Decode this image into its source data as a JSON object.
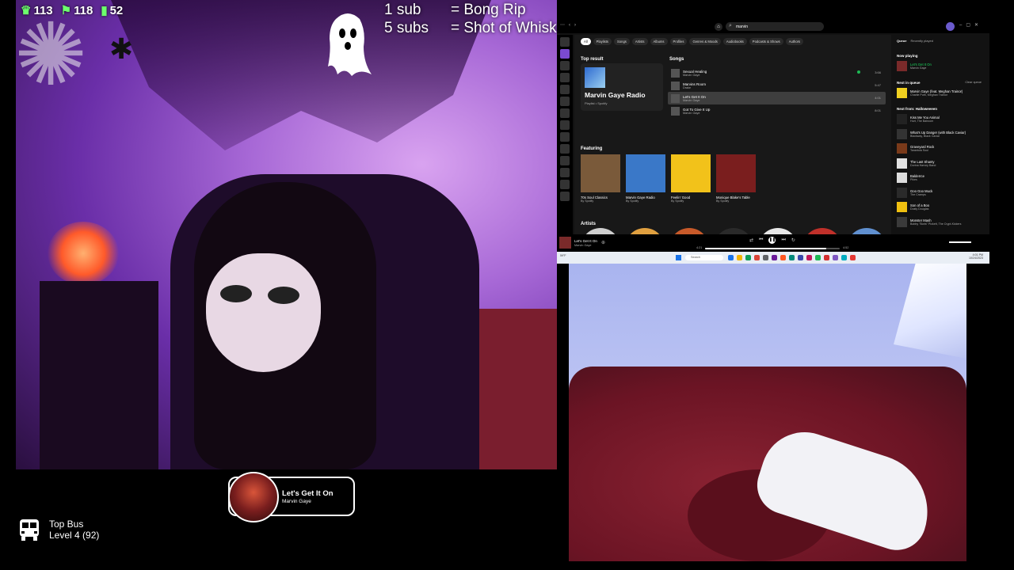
{
  "stats": {
    "item1": "113",
    "item2": "118",
    "item3": "52"
  },
  "sub_rules": [
    {
      "key": "1 sub",
      "value": "= Bong Rip"
    },
    {
      "key": "5 subs",
      "value": "= Shot of Whiskey"
    }
  ],
  "spotify": {
    "search_query": "marvin",
    "filter_chips": [
      "All",
      "Playlists",
      "Songs",
      "Artists",
      "Albums",
      "Profiles",
      "Genres & Moods",
      "Audiobooks",
      "Podcasts & Shows",
      "Authors"
    ],
    "top_result": {
      "heading": "Top result",
      "name": "Marvin Gaye Radio",
      "sub": "Playlist • Spotify"
    },
    "songs": {
      "heading": "Songs",
      "items": [
        {
          "title": "Sexual Healing",
          "artist": "Marvin Gaye",
          "duration": "3:66"
        },
        {
          "title": "Marvins Room",
          "artist": "Drake",
          "duration": "5:47"
        },
        {
          "title": "Let's Get It On",
          "artist": "Marvin Gaye",
          "duration": "4:01"
        },
        {
          "title": "Got To Give It Up",
          "artist": "Marvin Gaye",
          "duration": "8:01"
        }
      ]
    },
    "featuring": {
      "heading": "Featuring",
      "items": [
        {
          "title": "70s Soul Classics",
          "sub": "By Spotify",
          "color": "#7a5a3a"
        },
        {
          "title": "Marvin Gaye Radio",
          "sub": "By Spotify",
          "color": "#3a78c8"
        },
        {
          "title": "Feelin' Good",
          "sub": "By Spotify",
          "color": "#f2c21a"
        },
        {
          "title": "Monique Blake's Table",
          "sub": "By Spotify",
          "color": "#7a1e1e"
        }
      ]
    },
    "artists_heading": "Artists",
    "artist_colors": [
      "#cfcfcf",
      "#e0a040",
      "#c85a2a",
      "#2a2a2a",
      "#e8e8e8",
      "#c0302a",
      "#6090d0"
    ],
    "queue": {
      "tab_queue": "Queue",
      "tab_recent": "Recently played",
      "now_playing_heading": "Now playing",
      "now_playing": {
        "title": "Let's Get It On",
        "artist": "Marvin Gaye",
        "color": "#7a2a2a"
      },
      "next_heading": "Next in queue",
      "clear_label": "Clear queue",
      "next_in_queue": {
        "title": "Marvin Gaye (feat. Meghan Trainor)",
        "artist": "Charlie Puth, Meghan Trainor",
        "color": "#f0d020"
      },
      "next_from_heading": "Next from: Halloweeeen",
      "next_from": [
        {
          "title": "Kiss Me You Animal",
          "artist": "Hurt, The Balroom",
          "color": "#222222"
        },
        {
          "title": "What's Up Danger (with Black Caviar)",
          "artist": "Blackway, Black Caviar",
          "color": "#333333"
        },
        {
          "title": "Graveyard Rock",
          "artist": "Tarantula Soul",
          "color": "#7a3a1a"
        },
        {
          "title": "The Last Shanty",
          "artist": "Dorina Harvey Band",
          "color": "#e0e0e0"
        },
        {
          "title": "Balderrce",
          "artist": "Pikes",
          "color": "#dddddd"
        },
        {
          "title": "Goo Goo Muck",
          "artist": "The Cramps",
          "color": "#2a2a2a"
        },
        {
          "title": "Son of a Boo",
          "artist": "Dusty Douglas",
          "color": "#f0c010"
        },
        {
          "title": "Monster Mash",
          "artist": "Bobby \"Boris\" Pickett, The Crypt-Kickers",
          "color": "#3a3a3a"
        }
      ]
    },
    "player": {
      "title": "Let's Get It On",
      "artist": "Marvin Gaye",
      "current": "4:21",
      "duration": "4:52",
      "progress": 0.9
    }
  },
  "taskbar": {
    "search_placeholder": "Search",
    "weather": "59°F",
    "time": "4:01 PM",
    "date": "10/24/2023",
    "app_colors": [
      "#1a73e8",
      "#f4b400",
      "#0f9d58",
      "#db4437",
      "#5f6368",
      "#6a1b9a",
      "#ff5722",
      "#00897b",
      "#3949ab",
      "#c2185b",
      "#1db954",
      "#d32f2f",
      "#7e57c2",
      "#00acc1",
      "#e53935"
    ]
  },
  "now_playing_widget": {
    "title": "Let's Get It On",
    "artist": "Marvin Gaye"
  },
  "top_bus": {
    "title": "Top Bus",
    "level": "Level 4  (92)"
  }
}
